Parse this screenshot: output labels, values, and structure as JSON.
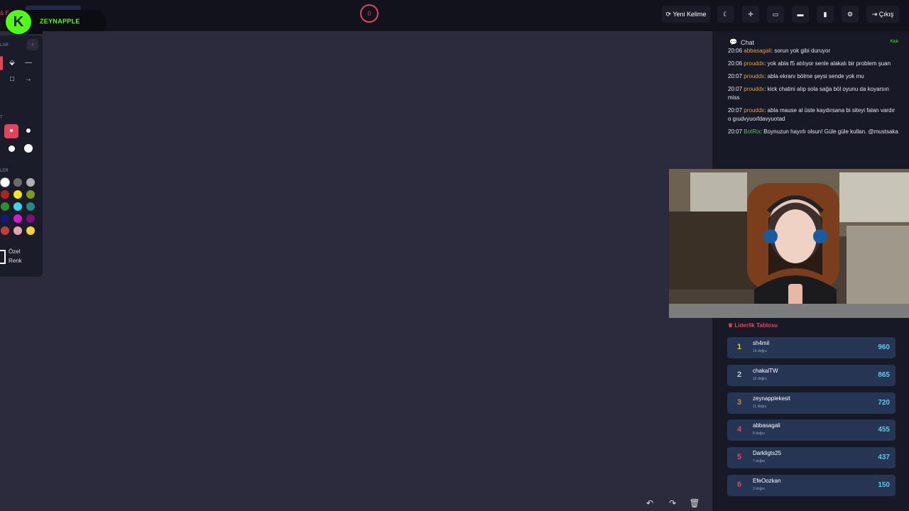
{
  "brand": {
    "logo_letter": "K",
    "username": "ZEYNAPPLE",
    "tab_prefix": "& E"
  },
  "timer": {
    "value": "0"
  },
  "toolbar": {
    "new_word_label": "Yeni Kelime",
    "exit_label": "Çıkış",
    "icons": [
      "moon-icon",
      "crosshair-icon",
      "keyboard-icon",
      "trash-can-icon",
      "trash-icon",
      "gear-icon"
    ]
  },
  "tools": {
    "section_shapes": "LAR",
    "section_sizes": "T",
    "section_colors": "LER",
    "custom_color_line1": "Özel",
    "custom_color_line2": "Renk",
    "swatches": [
      "#ffffff",
      "#6b6b6b",
      "#b0b0b0",
      "#b32222",
      "#f5e61a",
      "#7d9a1f",
      "#2f8f2a",
      "#3fd2f0",
      "#1e8a80",
      "#171783",
      "#d41bd4",
      "#7a0f7a",
      "#c23d3d",
      "#e8a3b0",
      "#f5d638"
    ]
  },
  "chat": {
    "title": "Chat",
    "source": "Kick",
    "messages": [
      {
        "time": "20:06",
        "user": "abbasagali",
        "text": "sorun yok gibi duruyor",
        "bot": false
      },
      {
        "time": "20:06",
        "user": "prouddx",
        "text": "yok abla f5 atılıyor senle alakalı bir problem şuan",
        "bot": false
      },
      {
        "time": "20:07",
        "user": "prouddx",
        "text": "abla ekranı bölme şeysi sende yok mu",
        "bot": false
      },
      {
        "time": "20:07",
        "user": "prouddx",
        "text": "kick chatini alıp sola sağa böl oyunu da koyarsın miss",
        "bot": false
      },
      {
        "time": "20:07",
        "user": "prouddx",
        "text": "abla mause al üste kaydırsana bi siteyi falan vardır o gıudvyuoıfdavyuotad",
        "bot": false
      },
      {
        "time": "20:07",
        "user": "BotRix",
        "text": "Boynuzun hayırlı olsun! Güle güle kullan. @mustsaka",
        "bot": true
      }
    ]
  },
  "leaderboard": {
    "title": "Liderlik Tablosu",
    "rows": [
      {
        "rank": "1",
        "name": "sh4mil",
        "sub": "15 doğru",
        "score": "960",
        "color": "#f1c232"
      },
      {
        "rank": "2",
        "name": "chakalTW",
        "sub": "12 doğru",
        "score": "865",
        "color": "#c6c9d4"
      },
      {
        "rank": "3",
        "name": "zeynapplekesit",
        "sub": "11 doğru",
        "score": "720",
        "color": "#d08a3c"
      },
      {
        "rank": "4",
        "name": "abbasagali",
        "sub": "8 doğru",
        "score": "455",
        "color": "#e0455c"
      },
      {
        "rank": "5",
        "name": "Darkligts25",
        "sub": "7 doğru",
        "score": "437",
        "color": "#e0455c"
      },
      {
        "rank": "6",
        "name": "EfeOozkan",
        "sub": "3 doğru",
        "score": "150",
        "color": "#e0455c"
      }
    ]
  }
}
